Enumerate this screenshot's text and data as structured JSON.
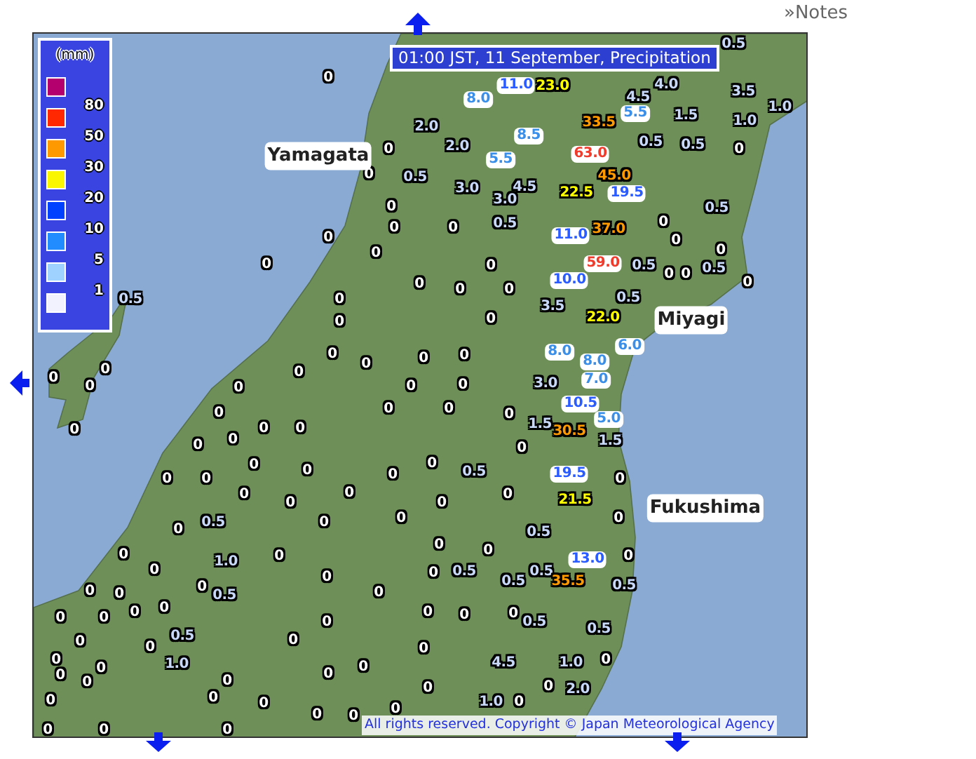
{
  "notes_link": "»Notes",
  "map": {
    "title": "01:00 JST, 11 September, Precipitation",
    "legend": {
      "unit": "(mm)",
      "swatches": [
        {
          "color": "#b4006e"
        },
        {
          "color": "#ff2800"
        },
        {
          "color": "#ff9900"
        },
        {
          "color": "#faf500"
        },
        {
          "color": "#0041ff"
        },
        {
          "color": "#218cff"
        },
        {
          "color": "#a0d2ff"
        },
        {
          "color": "#f2f2ff"
        }
      ],
      "labels": [
        "80",
        "50",
        "30",
        "20",
        "10",
        "5",
        "1"
      ]
    },
    "place_names": [
      {
        "name": "Yamagata"
      },
      {
        "name": "Miyagi"
      },
      {
        "name": "Fukushima"
      }
    ],
    "readings": [
      {
        "value": "0.5",
        "color": "#c8d8f8"
      },
      {
        "value": "0",
        "color": "#ffffff"
      },
      {
        "value": "8.0",
        "color": "#3b8fe8"
      },
      {
        "value": "11.0",
        "color": "#2a5cff"
      },
      {
        "value": "23.0",
        "color": "#ffff00"
      },
      {
        "value": "4.5",
        "color": "#c8d8f8"
      },
      {
        "value": "4.0",
        "color": "#c8d8f8"
      },
      {
        "value": "3.5",
        "color": "#c8d8f8"
      },
      {
        "value": "2.0",
        "color": "#c8d8f8"
      },
      {
        "value": "8.5",
        "color": "#3b8fe8"
      },
      {
        "value": "33.5",
        "color": "#ff9900"
      },
      {
        "value": "5.5",
        "color": "#3b8fe8"
      },
      {
        "value": "1.5",
        "color": "#c8d8f8"
      },
      {
        "value": "1.0",
        "color": "#c8d8f8"
      },
      {
        "value": "1.0",
        "color": "#c8d8f8"
      },
      {
        "value": "0",
        "color": "#ffffff"
      },
      {
        "value": "2.0",
        "color": "#c8d8f8"
      },
      {
        "value": "5.5",
        "color": "#3b8fe8"
      },
      {
        "value": "63.0",
        "color": "#f03c2c"
      },
      {
        "value": "0.5",
        "color": "#c8d8f8"
      },
      {
        "value": "0.5",
        "color": "#c8d8f8"
      },
      {
        "value": "0",
        "color": "#ffffff"
      },
      {
        "value": "0",
        "color": "#ffffff"
      },
      {
        "value": "0.5",
        "color": "#c8d8f8"
      },
      {
        "value": "3.0",
        "color": "#c8d8f8"
      },
      {
        "value": "4.5",
        "color": "#c8d8f8"
      },
      {
        "value": "22.5",
        "color": "#ffff00"
      },
      {
        "value": "45.0",
        "color": "#ff9900"
      },
      {
        "value": "19.5",
        "color": "#2a5cff"
      },
      {
        "value": "0",
        "color": "#ffffff"
      },
      {
        "value": "3.0",
        "color": "#c8d8f8"
      },
      {
        "value": "0.5",
        "color": "#c8d8f8"
      },
      {
        "value": "0",
        "color": "#ffffff"
      },
      {
        "value": "0",
        "color": "#ffffff"
      },
      {
        "value": "0",
        "color": "#ffffff"
      },
      {
        "value": "0.5",
        "color": "#c8d8f8"
      },
      {
        "value": "11.0",
        "color": "#2a5cff"
      },
      {
        "value": "37.0",
        "color": "#ff9900"
      },
      {
        "value": "0",
        "color": "#ffffff"
      },
      {
        "value": "0",
        "color": "#ffffff"
      },
      {
        "value": "0",
        "color": "#ffffff"
      },
      {
        "value": "0",
        "color": "#ffffff"
      },
      {
        "value": "0",
        "color": "#ffffff"
      },
      {
        "value": "0",
        "color": "#ffffff"
      },
      {
        "value": "59.0",
        "color": "#f03c2c"
      },
      {
        "value": "0.5",
        "color": "#c8d8f8"
      },
      {
        "value": "0",
        "color": "#ffffff"
      },
      {
        "value": "0",
        "color": "#ffffff"
      },
      {
        "value": "0.5",
        "color": "#c8d8f8"
      },
      {
        "value": "0.5",
        "color": "#c8d8f8"
      },
      {
        "value": "0",
        "color": "#ffffff"
      },
      {
        "value": "0",
        "color": "#ffffff"
      },
      {
        "value": "0",
        "color": "#ffffff"
      },
      {
        "value": "0",
        "color": "#ffffff"
      },
      {
        "value": "3.5",
        "color": "#c8d8f8"
      },
      {
        "value": "10.0",
        "color": "#2a5cff"
      },
      {
        "value": "0.5",
        "color": "#c8d8f8"
      },
      {
        "value": "0",
        "color": "#ffffff"
      },
      {
        "value": "0",
        "color": "#ffffff"
      },
      {
        "value": "0",
        "color": "#ffffff"
      },
      {
        "value": "22.0",
        "color": "#ffff00"
      },
      {
        "value": "0",
        "color": "#ffffff"
      },
      {
        "value": "0",
        "color": "#ffffff"
      },
      {
        "value": "0",
        "color": "#ffffff"
      },
      {
        "value": "0",
        "color": "#ffffff"
      },
      {
        "value": "8.0",
        "color": "#3b8fe8"
      },
      {
        "value": "8.0",
        "color": "#3b8fe8"
      },
      {
        "value": "6.0",
        "color": "#3b8fe8"
      },
      {
        "value": "0",
        "color": "#ffffff"
      },
      {
        "value": "0",
        "color": "#ffffff"
      },
      {
        "value": "0",
        "color": "#ffffff"
      },
      {
        "value": "0",
        "color": "#ffffff"
      },
      {
        "value": "0",
        "color": "#ffffff"
      },
      {
        "value": "0",
        "color": "#ffffff"
      },
      {
        "value": "0",
        "color": "#ffffff"
      },
      {
        "value": "3.0",
        "color": "#c8d8f8"
      },
      {
        "value": "7.0",
        "color": "#3b8fe8"
      },
      {
        "value": "0",
        "color": "#ffffff"
      },
      {
        "value": "0",
        "color": "#ffffff"
      },
      {
        "value": "0",
        "color": "#ffffff"
      },
      {
        "value": "0",
        "color": "#ffffff"
      },
      {
        "value": "10.5",
        "color": "#2a5cff"
      },
      {
        "value": "5.0",
        "color": "#3b8fe8"
      },
      {
        "value": "0",
        "color": "#ffffff"
      },
      {
        "value": "0",
        "color": "#ffffff"
      },
      {
        "value": "0",
        "color": "#ffffff"
      },
      {
        "value": "0",
        "color": "#ffffff"
      },
      {
        "value": "0",
        "color": "#ffffff"
      },
      {
        "value": "0",
        "color": "#ffffff"
      },
      {
        "value": "1.5",
        "color": "#c8d8f8"
      },
      {
        "value": "30.5",
        "color": "#ff9900"
      },
      {
        "value": "1.5",
        "color": "#c8d8f8"
      },
      {
        "value": "0",
        "color": "#ffffff"
      },
      {
        "value": "0",
        "color": "#ffffff"
      },
      {
        "value": "0",
        "color": "#ffffff"
      },
      {
        "value": "0",
        "color": "#ffffff"
      },
      {
        "value": "0",
        "color": "#ffffff"
      },
      {
        "value": "0",
        "color": "#ffffff"
      },
      {
        "value": "0.5",
        "color": "#c8d8f8"
      },
      {
        "value": "19.5",
        "color": "#2a5cff"
      },
      {
        "value": "0",
        "color": "#ffffff"
      },
      {
        "value": "0",
        "color": "#ffffff"
      },
      {
        "value": "0",
        "color": "#ffffff"
      },
      {
        "value": "0",
        "color": "#ffffff"
      },
      {
        "value": "0",
        "color": "#ffffff"
      },
      {
        "value": "0",
        "color": "#ffffff"
      },
      {
        "value": "21.5",
        "color": "#ffff00"
      },
      {
        "value": "0",
        "color": "#ffffff"
      },
      {
        "value": "0.5",
        "color": "#c8d8f8"
      },
      {
        "value": "0",
        "color": "#ffffff"
      },
      {
        "value": "0",
        "color": "#ffffff"
      },
      {
        "value": "0.5",
        "color": "#c8d8f8"
      },
      {
        "value": "0",
        "color": "#ffffff"
      },
      {
        "value": "0",
        "color": "#ffffff"
      },
      {
        "value": "1.0",
        "color": "#c8d8f8"
      },
      {
        "value": "0",
        "color": "#ffffff"
      },
      {
        "value": "0",
        "color": "#ffffff"
      },
      {
        "value": "0",
        "color": "#ffffff"
      },
      {
        "value": "13.0",
        "color": "#2a5cff"
      },
      {
        "value": "0",
        "color": "#ffffff"
      },
      {
        "value": "0",
        "color": "#ffffff"
      },
      {
        "value": "0",
        "color": "#ffffff"
      },
      {
        "value": "0",
        "color": "#ffffff"
      },
      {
        "value": "0",
        "color": "#ffffff"
      },
      {
        "value": "0.5",
        "color": "#c8d8f8"
      },
      {
        "value": "0",
        "color": "#ffffff"
      },
      {
        "value": "0",
        "color": "#ffffff"
      },
      {
        "value": "0",
        "color": "#ffffff"
      },
      {
        "value": "0.5",
        "color": "#c8d8f8"
      },
      {
        "value": "0.5",
        "color": "#c8d8f8"
      },
      {
        "value": "0.5",
        "color": "#c8d8f8"
      },
      {
        "value": "35.5",
        "color": "#ff9900"
      },
      {
        "value": "0.5",
        "color": "#c8d8f8"
      },
      {
        "value": "0",
        "color": "#ffffff"
      },
      {
        "value": "0",
        "color": "#ffffff"
      },
      {
        "value": "0",
        "color": "#ffffff"
      },
      {
        "value": "0",
        "color": "#ffffff"
      },
      {
        "value": "0",
        "color": "#ffffff"
      },
      {
        "value": "0",
        "color": "#ffffff"
      },
      {
        "value": "0",
        "color": "#ffffff"
      },
      {
        "value": "0",
        "color": "#ffffff"
      },
      {
        "value": "0.5",
        "color": "#c8d8f8"
      },
      {
        "value": "0.5",
        "color": "#c8d8f8"
      },
      {
        "value": "0",
        "color": "#ffffff"
      },
      {
        "value": "0",
        "color": "#ffffff"
      },
      {
        "value": "0.5",
        "color": "#c8d8f8"
      },
      {
        "value": "0",
        "color": "#ffffff"
      },
      {
        "value": "0",
        "color": "#ffffff"
      },
      {
        "value": "0",
        "color": "#ffffff"
      },
      {
        "value": "0",
        "color": "#ffffff"
      },
      {
        "value": "0",
        "color": "#ffffff"
      },
      {
        "value": "1.0",
        "color": "#c8d8f8"
      },
      {
        "value": "0",
        "color": "#ffffff"
      },
      {
        "value": "0",
        "color": "#ffffff"
      },
      {
        "value": "4.5",
        "color": "#c8d8f8"
      },
      {
        "value": "1.0",
        "color": "#c8d8f8"
      },
      {
        "value": "0",
        "color": "#ffffff"
      },
      {
        "value": "0",
        "color": "#ffffff"
      },
      {
        "value": "0",
        "color": "#ffffff"
      },
      {
        "value": "0",
        "color": "#ffffff"
      },
      {
        "value": "0",
        "color": "#ffffff"
      },
      {
        "value": "0",
        "color": "#ffffff"
      },
      {
        "value": "0",
        "color": "#ffffff"
      },
      {
        "value": "1.0",
        "color": "#c8d8f8"
      },
      {
        "value": "0",
        "color": "#ffffff"
      },
      {
        "value": "0",
        "color": "#ffffff"
      },
      {
        "value": "2.0",
        "color": "#c8d8f8"
      },
      {
        "value": "0",
        "color": "#ffffff"
      },
      {
        "value": "0",
        "color": "#ffffff"
      },
      {
        "value": "0",
        "color": "#ffffff"
      },
      {
        "value": "0",
        "color": "#ffffff"
      },
      {
        "value": "0",
        "color": "#ffffff"
      },
      {
        "value": "0",
        "color": "#ffffff"
      }
    ],
    "copyright": "All rights reserved. Copyright © Japan Meteorological Agency"
  }
}
